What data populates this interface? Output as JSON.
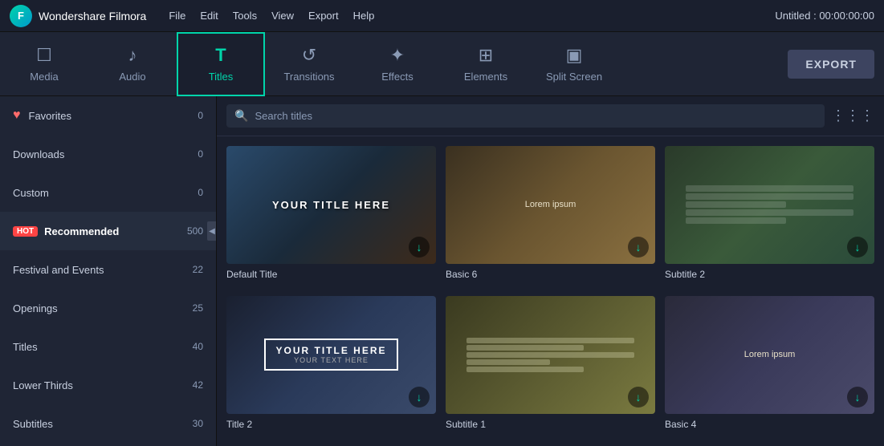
{
  "titlebar": {
    "app_name": "Wondershare Filmora",
    "logo_letter": "F",
    "menu_items": [
      "File",
      "Edit",
      "Tools",
      "View",
      "Export",
      "Help"
    ],
    "project_info": "Untitled : 00:00:00:00"
  },
  "nav": {
    "tabs": [
      {
        "id": "media",
        "label": "Media",
        "icon": "□"
      },
      {
        "id": "audio",
        "label": "Audio",
        "icon": "♪"
      },
      {
        "id": "titles",
        "label": "Titles",
        "icon": "T",
        "active": true
      },
      {
        "id": "transitions",
        "label": "Transitions",
        "icon": "⟳"
      },
      {
        "id": "effects",
        "label": "Effects",
        "icon": "✦"
      },
      {
        "id": "elements",
        "label": "Elements",
        "icon": "⊞"
      },
      {
        "id": "splitscreen",
        "label": "Split Screen",
        "icon": "▣"
      }
    ],
    "export_label": "EXPORT"
  },
  "sidebar": {
    "items": [
      {
        "id": "favorites",
        "label": "Favorites",
        "count": "0",
        "has_heart": true
      },
      {
        "id": "downloads",
        "label": "Downloads",
        "count": "0"
      },
      {
        "id": "custom",
        "label": "Custom",
        "count": "0"
      },
      {
        "id": "recommended",
        "label": "Recommended",
        "count": "500",
        "has_hot": true,
        "active": true
      },
      {
        "id": "festival",
        "label": "Festival and Events",
        "count": "22"
      },
      {
        "id": "openings",
        "label": "Openings",
        "count": "25"
      },
      {
        "id": "titles",
        "label": "Titles",
        "count": "40"
      },
      {
        "id": "lowerthirds",
        "label": "Lower Thirds",
        "count": "42"
      },
      {
        "id": "subtitles",
        "label": "Subtitles",
        "count": "30"
      }
    ]
  },
  "search": {
    "placeholder": "Search titles"
  },
  "thumbnails": [
    {
      "id": "default-title",
      "label": "Default Title",
      "style": "default-title",
      "content_type": "title_text",
      "text": "YOUR TITLE HERE"
    },
    {
      "id": "basic6",
      "label": "Basic 6",
      "style": "basic6",
      "content_type": "lorem",
      "text": "Lorem ipsum"
    },
    {
      "id": "subtitle2",
      "label": "Subtitle 2",
      "style": "subtitle2",
      "content_type": "subtitle_lines"
    },
    {
      "id": "title2",
      "label": "Title 2",
      "style": "title2",
      "content_type": "box_title",
      "main_text": "YOUR TITLE HERE",
      "sub_text": "YOUR TEXT HERE"
    },
    {
      "id": "subtitle1",
      "label": "Subtitle 1",
      "style": "subtitle1",
      "content_type": "lorem_block"
    },
    {
      "id": "basic4",
      "label": "Basic 4",
      "style": "basic4",
      "content_type": "lorem",
      "text": "Lorem ipsum"
    }
  ]
}
